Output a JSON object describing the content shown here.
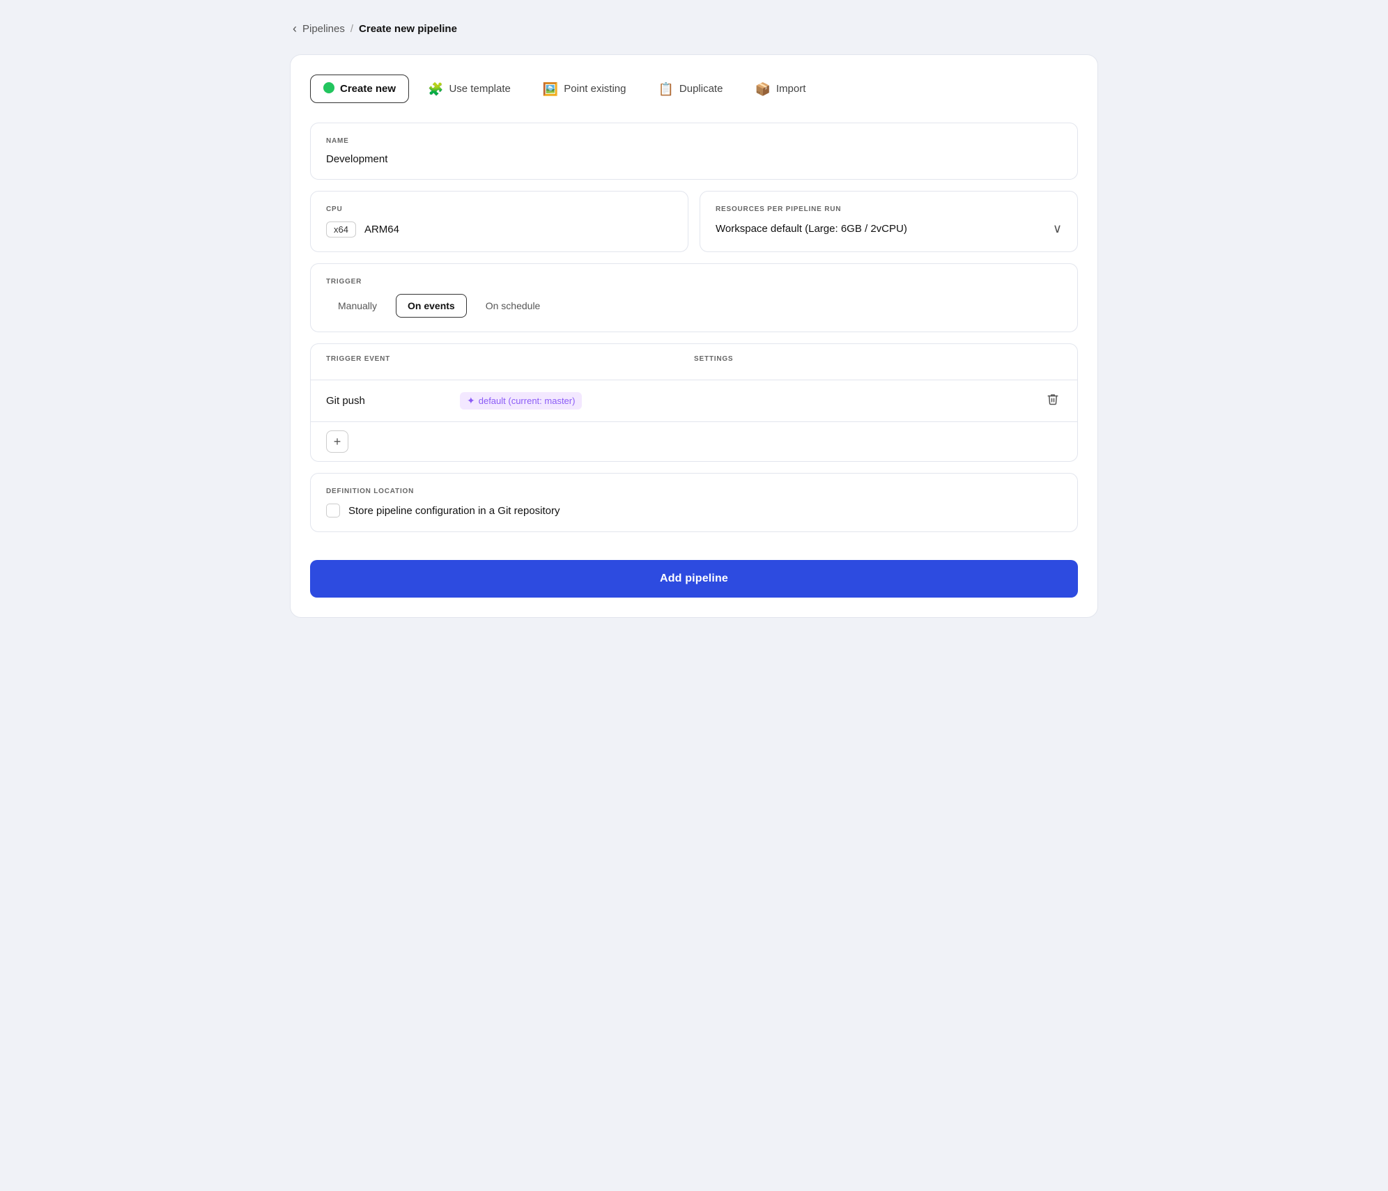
{
  "breadcrumb": {
    "back_label": "‹",
    "link_label": "Pipelines",
    "separator": "/",
    "current_label": "Create new pipeline"
  },
  "tabs": [
    {
      "id": "create-new",
      "label": "Create new",
      "icon": "🟢",
      "active": true
    },
    {
      "id": "use-template",
      "label": "Use template",
      "icon": "🧩",
      "active": false
    },
    {
      "id": "point-existing",
      "label": "Point existing",
      "icon": "🖼️",
      "active": false
    },
    {
      "id": "duplicate",
      "label": "Duplicate",
      "icon": "📋",
      "active": false
    },
    {
      "id": "import",
      "label": "Import",
      "icon": "📦",
      "active": false
    }
  ],
  "name_section": {
    "label": "NAME",
    "value": "Development"
  },
  "cpu_section": {
    "label": "CPU",
    "option1": "x64",
    "option2": "ARM64"
  },
  "resources_section": {
    "label": "RESOURCES PER PIPELINE RUN",
    "value": "Workspace default (Large: 6GB / 2vCPU)"
  },
  "trigger_section": {
    "label": "TRIGGER",
    "options": [
      {
        "label": "Manually",
        "active": false
      },
      {
        "label": "On events",
        "active": true
      },
      {
        "label": "On schedule",
        "active": false
      }
    ]
  },
  "trigger_event_section": {
    "col1_label": "TRIGGER EVENT",
    "col2_label": "SETTINGS",
    "row": {
      "event": "Git push",
      "branch_label": "default (current: master)"
    },
    "add_btn_label": "+"
  },
  "definition_section": {
    "label": "DEFINITION LOCATION",
    "checkbox_label": "Store pipeline configuration in a Git repository"
  },
  "add_pipeline_btn": "Add pipeline"
}
